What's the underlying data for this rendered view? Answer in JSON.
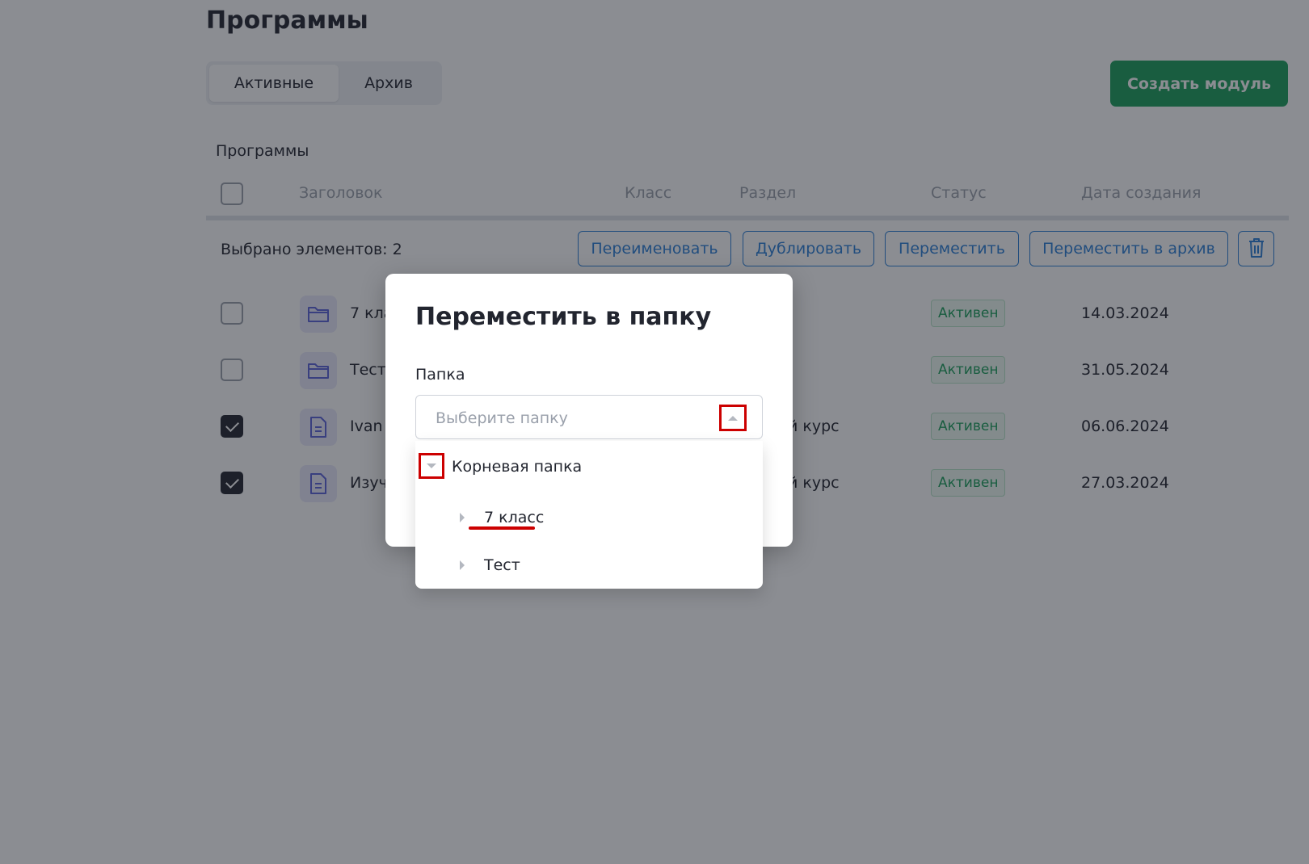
{
  "page": {
    "title": "Программы"
  },
  "tabs": [
    {
      "label": "Активные",
      "active": true
    },
    {
      "label": "Архив",
      "active": false
    }
  ],
  "create_button": {
    "label": "Создать модуль",
    "color": "#1a9f5b"
  },
  "table": {
    "caption": "Программы",
    "columns": [
      "Заголовок",
      "Класс",
      "Раздел",
      "Статус",
      "Дата создания"
    ],
    "bulk": {
      "selected_text": "Выбрано элементов: 2",
      "actions": [
        "Переименовать",
        "Дублировать",
        "Переместить",
        "Переместить в архив"
      ],
      "delete_icon": "trash-icon"
    },
    "rows": [
      {
        "icon": "folder-icon",
        "title": "7 кла",
        "section": "",
        "status": "Активен",
        "date": "14.03.2024",
        "checked": false
      },
      {
        "icon": "folder-icon",
        "title": "Тест",
        "section": "",
        "status": "Активен",
        "date": "31.05.2024",
        "checked": false
      },
      {
        "icon": "document-icon",
        "title": "Ivan",
        "section": "й курс",
        "status": "Активен",
        "date": "06.06.2024",
        "checked": true
      },
      {
        "icon": "document-icon",
        "title": "Изуч",
        "section": "й курс",
        "status": "Активен",
        "date": "27.03.2024",
        "checked": true
      }
    ],
    "status_color": "#1a9f5b"
  },
  "modal": {
    "title": "Переместить в папку",
    "field_label": "Папка",
    "select_placeholder": "Выберите папку",
    "tree": {
      "root": "Корневая папка",
      "children": [
        "7 класс",
        "Тест"
      ]
    }
  },
  "colors": {
    "accent": "#2b7fd6",
    "highlight": "#cc0000",
    "overlay": "#181b26"
  }
}
